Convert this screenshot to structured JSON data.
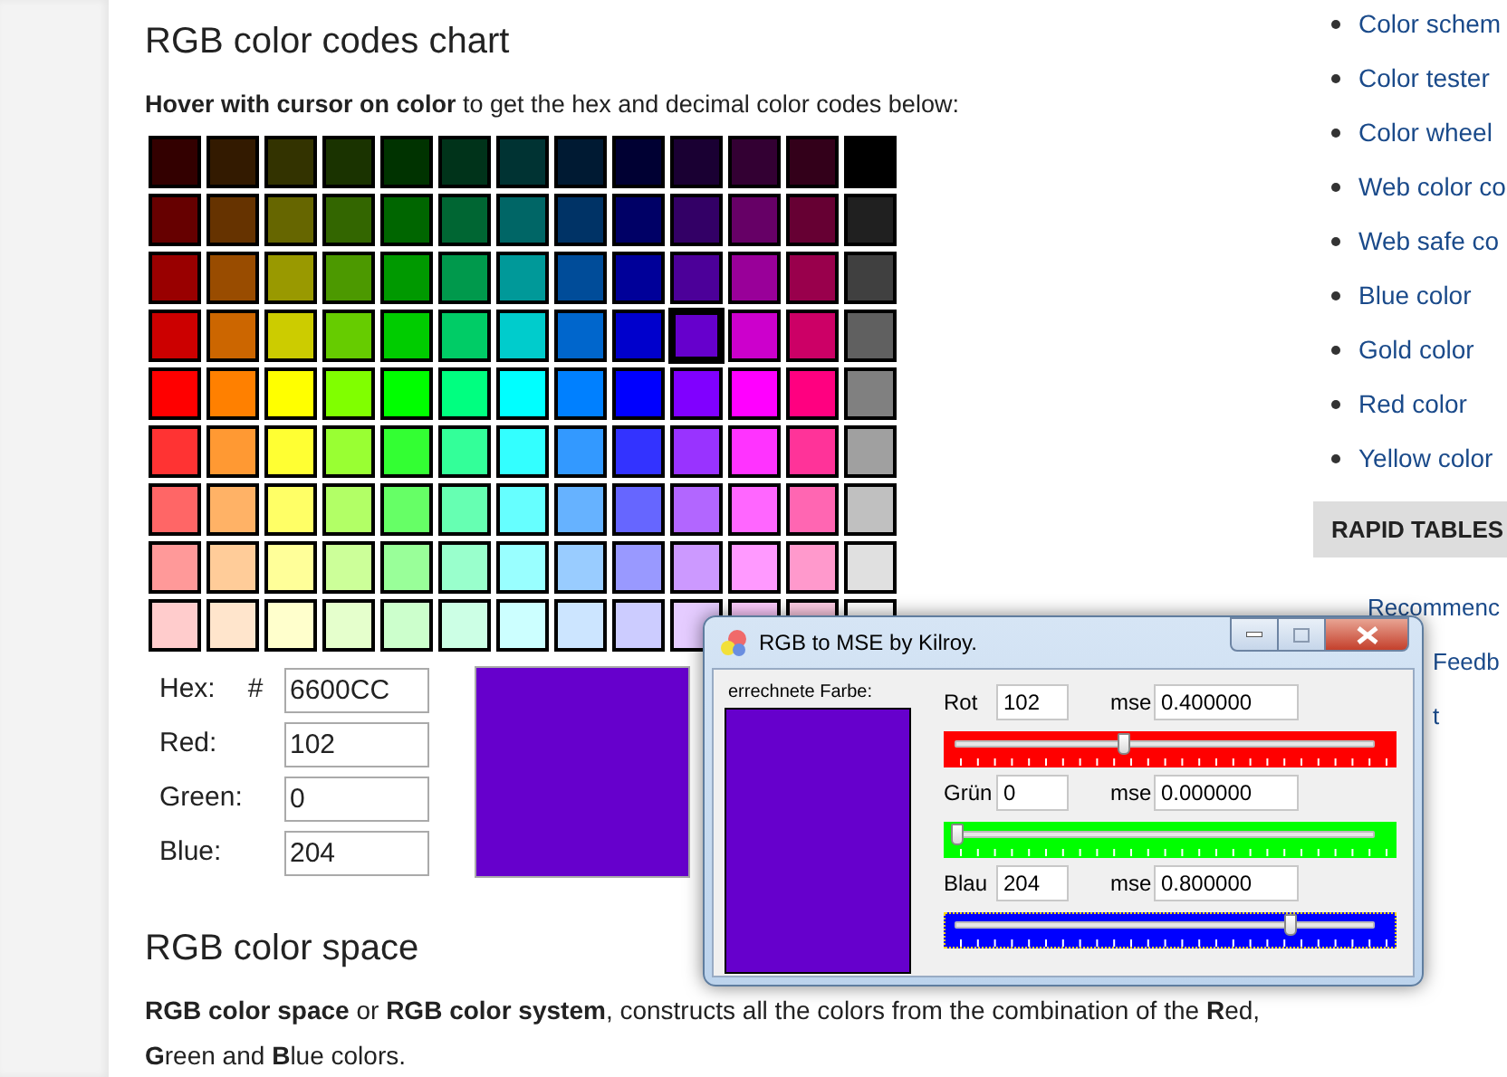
{
  "page": {
    "title": "RGB color codes chart",
    "intro": "**Hover with cursor on color** to get the hex and decimal color codes below:"
  },
  "color_grid": {
    "rows": [
      {
        "cells": [
          {
            "color": "#330000",
            "selected": false
          },
          {
            "color": "#331a00",
            "selected": false
          },
          {
            "color": "#333300",
            "selected": false
          },
          {
            "color": "#1a3300",
            "selected": false
          },
          {
            "color": "#003300",
            "selected": false
          },
          {
            "color": "#00331a",
            "selected": false
          },
          {
            "color": "#003333",
            "selected": false
          },
          {
            "color": "#001a33",
            "selected": false
          },
          {
            "color": "#000033",
            "selected": false
          },
          {
            "color": "#1a0033",
            "selected": false
          },
          {
            "color": "#330033",
            "selected": false
          },
          {
            "color": "#33001a",
            "selected": false
          },
          {
            "color": "#000000",
            "selected": false
          }
        ]
      },
      {
        "cells": [
          {
            "color": "#660000",
            "selected": false
          },
          {
            "color": "#663300",
            "selected": false
          },
          {
            "color": "#666600",
            "selected": false
          },
          {
            "color": "#336600",
            "selected": false
          },
          {
            "color": "#006600",
            "selected": false
          },
          {
            "color": "#006633",
            "selected": false
          },
          {
            "color": "#006666",
            "selected": false
          },
          {
            "color": "#003366",
            "selected": false
          },
          {
            "color": "#000066",
            "selected": false
          },
          {
            "color": "#330066",
            "selected": false
          },
          {
            "color": "#660066",
            "selected": false
          },
          {
            "color": "#660033",
            "selected": false
          },
          {
            "color": "#202020",
            "selected": false
          }
        ]
      },
      {
        "cells": [
          {
            "color": "#990000",
            "selected": false
          },
          {
            "color": "#994c00",
            "selected": false
          },
          {
            "color": "#999900",
            "selected": false
          },
          {
            "color": "#4c9900",
            "selected": false
          },
          {
            "color": "#009900",
            "selected": false
          },
          {
            "color": "#00994c",
            "selected": false
          },
          {
            "color": "#009999",
            "selected": false
          },
          {
            "color": "#004c99",
            "selected": false
          },
          {
            "color": "#000099",
            "selected": false
          },
          {
            "color": "#4c0099",
            "selected": false
          },
          {
            "color": "#990099",
            "selected": false
          },
          {
            "color": "#99004c",
            "selected": false
          },
          {
            "color": "#404040",
            "selected": false
          }
        ]
      },
      {
        "cells": [
          {
            "color": "#cc0000",
            "selected": false
          },
          {
            "color": "#cc6600",
            "selected": false
          },
          {
            "color": "#cccc00",
            "selected": false
          },
          {
            "color": "#66cc00",
            "selected": false
          },
          {
            "color": "#00cc00",
            "selected": false
          },
          {
            "color": "#00cc66",
            "selected": false
          },
          {
            "color": "#00cccc",
            "selected": false
          },
          {
            "color": "#0066cc",
            "selected": false
          },
          {
            "color": "#0000cc",
            "selected": false
          },
          {
            "color": "#6600cc",
            "selected": true
          },
          {
            "color": "#cc00cc",
            "selected": false
          },
          {
            "color": "#cc0066",
            "selected": false
          },
          {
            "color": "#606060",
            "selected": false
          }
        ]
      },
      {
        "cells": [
          {
            "color": "#ff0000",
            "selected": false
          },
          {
            "color": "#ff8000",
            "selected": false
          },
          {
            "color": "#ffff00",
            "selected": false
          },
          {
            "color": "#80ff00",
            "selected": false
          },
          {
            "color": "#00ff00",
            "selected": false
          },
          {
            "color": "#00ff80",
            "selected": false
          },
          {
            "color": "#00ffff",
            "selected": false
          },
          {
            "color": "#0080ff",
            "selected": false
          },
          {
            "color": "#0000ff",
            "selected": false
          },
          {
            "color": "#8000ff",
            "selected": false
          },
          {
            "color": "#ff00ff",
            "selected": false
          },
          {
            "color": "#ff0080",
            "selected": false
          },
          {
            "color": "#808080",
            "selected": false
          }
        ]
      },
      {
        "cells": [
          {
            "color": "#ff3333",
            "selected": false
          },
          {
            "color": "#ff9933",
            "selected": false
          },
          {
            "color": "#ffff33",
            "selected": false
          },
          {
            "color": "#99ff33",
            "selected": false
          },
          {
            "color": "#33ff33",
            "selected": false
          },
          {
            "color": "#33ff99",
            "selected": false
          },
          {
            "color": "#33ffff",
            "selected": false
          },
          {
            "color": "#3399ff",
            "selected": false
          },
          {
            "color": "#3333ff",
            "selected": false
          },
          {
            "color": "#9933ff",
            "selected": false
          },
          {
            "color": "#ff33ff",
            "selected": false
          },
          {
            "color": "#ff3399",
            "selected": false
          },
          {
            "color": "#a0a0a0",
            "selected": false
          }
        ]
      },
      {
        "cells": [
          {
            "color": "#ff6666",
            "selected": false
          },
          {
            "color": "#ffb266",
            "selected": false
          },
          {
            "color": "#ffff66",
            "selected": false
          },
          {
            "color": "#b2ff66",
            "selected": false
          },
          {
            "color": "#66ff66",
            "selected": false
          },
          {
            "color": "#66ffb2",
            "selected": false
          },
          {
            "color": "#66ffff",
            "selected": false
          },
          {
            "color": "#66b2ff",
            "selected": false
          },
          {
            "color": "#6666ff",
            "selected": false
          },
          {
            "color": "#b266ff",
            "selected": false
          },
          {
            "color": "#ff66ff",
            "selected": false
          },
          {
            "color": "#ff66b2",
            "selected": false
          },
          {
            "color": "#c0c0c0",
            "selected": false
          }
        ]
      },
      {
        "cells": [
          {
            "color": "#ff9999",
            "selected": false
          },
          {
            "color": "#ffcc99",
            "selected": false
          },
          {
            "color": "#ffff99",
            "selected": false
          },
          {
            "color": "#ccff99",
            "selected": false
          },
          {
            "color": "#99ff99",
            "selected": false
          },
          {
            "color": "#99ffcc",
            "selected": false
          },
          {
            "color": "#99ffff",
            "selected": false
          },
          {
            "color": "#99ccff",
            "selected": false
          },
          {
            "color": "#9999ff",
            "selected": false
          },
          {
            "color": "#cc99ff",
            "selected": false
          },
          {
            "color": "#ff99ff",
            "selected": false
          },
          {
            "color": "#ff99cc",
            "selected": false
          },
          {
            "color": "#e0e0e0",
            "selected": false
          }
        ]
      },
      {
        "cells": [
          {
            "color": "#ffcccc",
            "selected": false
          },
          {
            "color": "#ffe5cc",
            "selected": false
          },
          {
            "color": "#ffffcc",
            "selected": false
          },
          {
            "color": "#e5ffcc",
            "selected": false
          },
          {
            "color": "#ccffcc",
            "selected": false
          },
          {
            "color": "#ccffe5",
            "selected": false
          },
          {
            "color": "#ccffff",
            "selected": false
          },
          {
            "color": "#cce5ff",
            "selected": false
          },
          {
            "color": "#ccccff",
            "selected": false
          },
          {
            "color": "#e5ccff",
            "selected": false
          },
          {
            "color": "#ffccff",
            "selected": false
          },
          {
            "color": "#ffcce5",
            "selected": false
          },
          {
            "color": "#ffffff",
            "selected": false
          }
        ]
      }
    ]
  },
  "color_codes": {
    "fields": [
      {
        "label": "Hex:",
        "prefix": "#",
        "value": "6600CC"
      },
      {
        "label": "Red:",
        "value": "102"
      },
      {
        "label": "Green:",
        "value": "0"
      },
      {
        "label": "Blue:",
        "value": "204"
      }
    ],
    "color": "#6600cc"
  },
  "section": {
    "title": "RGB color space",
    "text": "**RGB color space** or **RGB color system**, constructs all the colors from the combination of the **R**ed, **G**reen and **B**lue colors."
  },
  "sidebar": {
    "links": [
      "Color schem",
      "Color tester",
      "Color wheel",
      "Web color co",
      "Web safe co",
      "Blue color",
      "Gold color",
      "Red color",
      "Yellow color"
    ],
    "header": "RAPID TABLES",
    "links_2": [
      "Recommenc",
      "Feedb",
      "t"
    ]
  },
  "dialog": {
    "title": "RGB to MSE by Kilroy.",
    "preview_label": "errechnete Farbe:",
    "color": "#6600cc",
    "channels": [
      {
        "label": "Rot",
        "value": "102",
        "mse_label": "mse",
        "mse": "0.400000",
        "color": "#ff0000",
        "level": 0.4,
        "focused": false
      },
      {
        "label": "Grün",
        "value": "0",
        "mse_label": "mse",
        "mse": "0.000000",
        "color": "#00ff00",
        "level": 0,
        "focused": false
      },
      {
        "label": "Blau",
        "value": "204",
        "mse_label": "mse",
        "mse": "0.800000",
        "color": "#0000ff",
        "level": 0.8,
        "focused": true
      }
    ]
  }
}
